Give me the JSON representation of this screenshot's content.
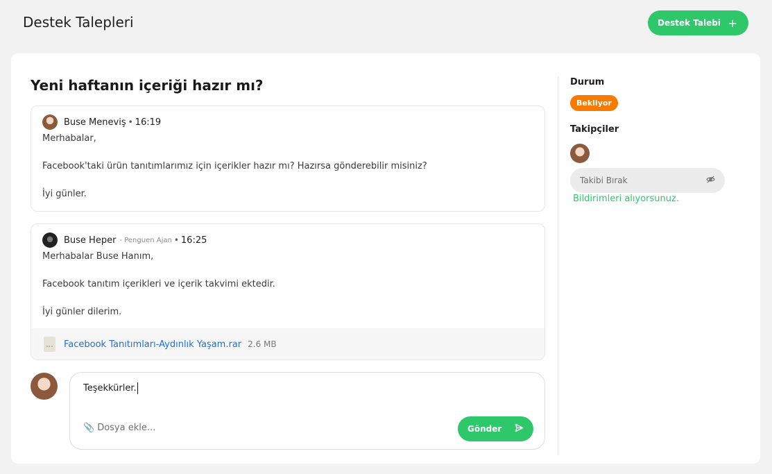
{
  "header": {
    "title": "Destek Talepleri",
    "new_ticket_label": "Destek Talebi",
    "new_ticket_icon": "plus-icon"
  },
  "ticket": {
    "title": "Yeni haftanın içeriği hazır mı?"
  },
  "messages": [
    {
      "author": "Buse Meneviş",
      "time": "16:19",
      "lines": [
        "Merhabalar,",
        "Facebook'taki ürün tanıtımlarımız için içerikler hazır mı? Hazırsa gönderebilir misiniz?",
        "İyi günler."
      ]
    },
    {
      "author": "Buse Heper",
      "role": "- Penguen Ajan",
      "time": "16:25",
      "lines": [
        "Merhabalar Buse Hanım,",
        "Facebook tanıtım içerikleri ve içerik takvimi ektedir.",
        "İyi günler dilerim."
      ],
      "attachment": {
        "name": "Facebook Tanıtımları-Aydınlık Yaşam.rar",
        "size": "2.6 MB"
      }
    }
  ],
  "composer": {
    "value": "Teşekkürler.",
    "attach_label": "Dosya ekle...",
    "send_label": "Gönder"
  },
  "sidebar": {
    "status_label": "Durum",
    "status_value": "Bekliyor",
    "followers_label": "Takipçiler",
    "unfollow_label": "Takibi Bırak",
    "notify_text": "Bildirimleri alıyorsunuz."
  },
  "colors": {
    "accent": "#2ec86b",
    "status_pending": "#f57c00",
    "link": "#1d6fd6"
  }
}
